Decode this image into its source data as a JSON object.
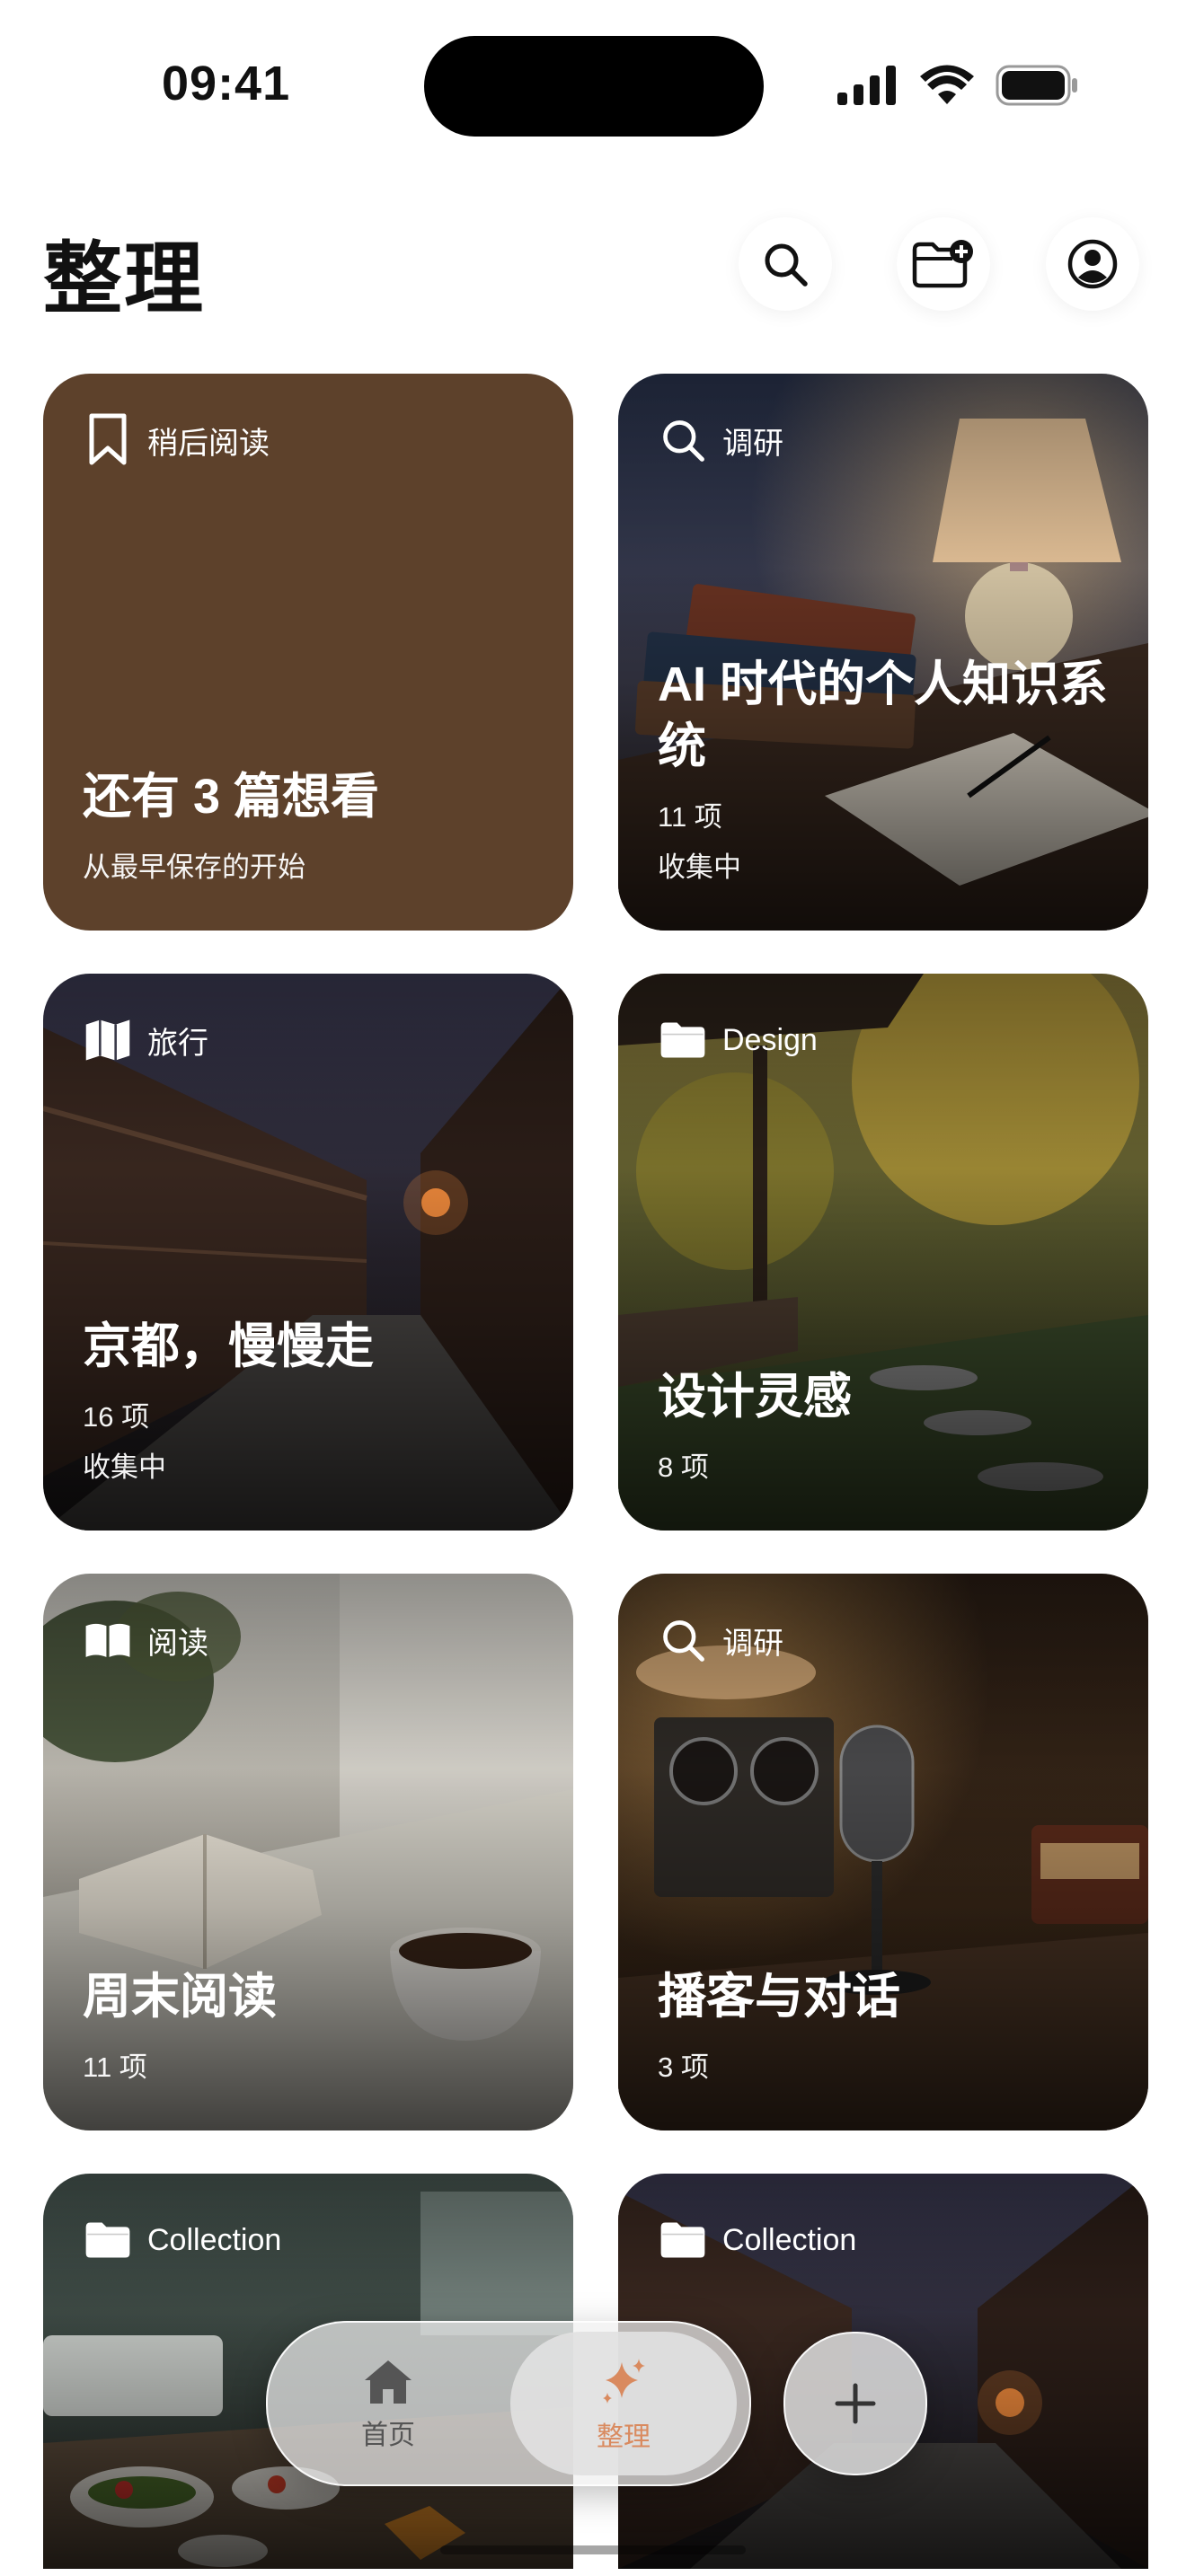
{
  "status_bar": {
    "time": "09:41"
  },
  "header": {
    "title": "整理"
  },
  "cards": [
    {
      "tag": "稍后阅读",
      "icon": "bookmark-icon",
      "title": "还有 3 篇想看",
      "meta1": "从最早保存的开始",
      "meta2": ""
    },
    {
      "tag": "调研",
      "icon": "search-icon",
      "title": "AI 时代的个人知识系统",
      "meta1": "11 项",
      "meta2": "收集中"
    },
    {
      "tag": "旅行",
      "icon": "map-icon",
      "title": "京都，慢慢走",
      "meta1": "16 项",
      "meta2": "收集中"
    },
    {
      "tag": "Design",
      "icon": "folder-icon",
      "title": "设计灵感",
      "meta1": "8 项",
      "meta2": ""
    },
    {
      "tag": "阅读",
      "icon": "book-icon",
      "title": "周末阅读",
      "meta1": "11 项",
      "meta2": ""
    },
    {
      "tag": "调研",
      "icon": "search-icon",
      "title": "播客与对话",
      "meta1": "3 项",
      "meta2": ""
    },
    {
      "tag": "Collection",
      "icon": "folder-icon",
      "title": "",
      "meta1": "",
      "meta2": ""
    },
    {
      "tag": "Collection",
      "icon": "folder-icon",
      "title": "",
      "meta1": "",
      "meta2": ""
    }
  ],
  "tab_bar": {
    "home_label": "首页",
    "organize_label": "整理",
    "active_color": "#d98a5f"
  },
  "colors": {
    "bookmark_card": "#5d412b"
  }
}
